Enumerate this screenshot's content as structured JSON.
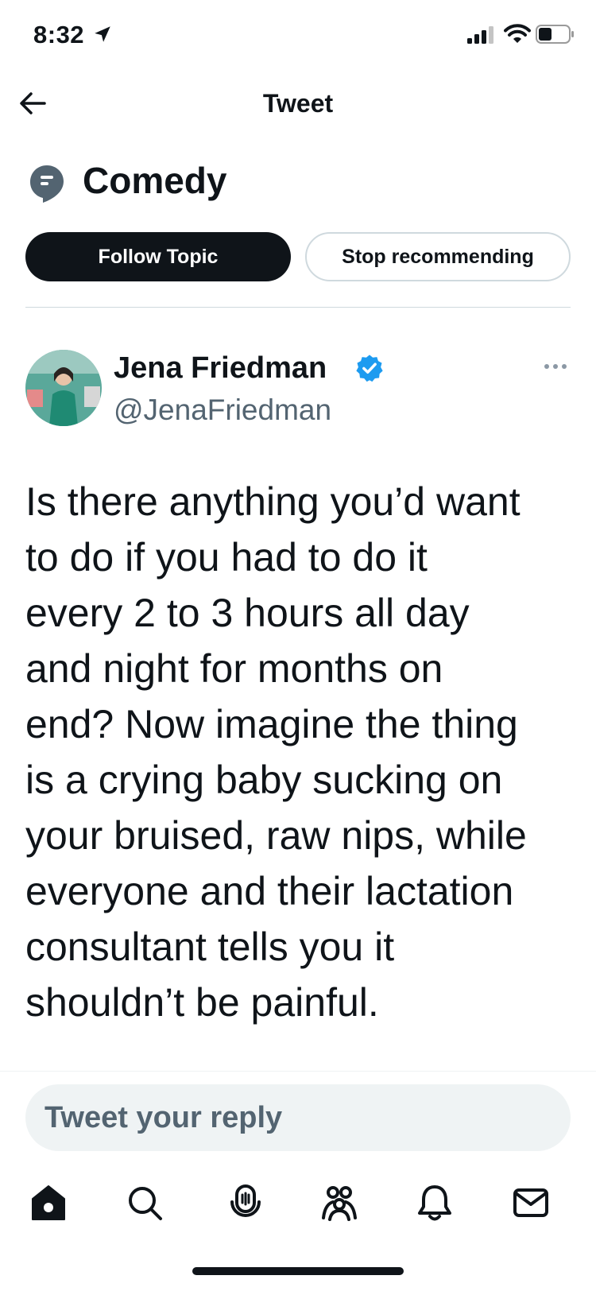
{
  "status_bar": {
    "time": "8:32",
    "icons": [
      "location-arrow-icon",
      "cellular-signal-icon",
      "wifi-icon",
      "battery-icon"
    ]
  },
  "header": {
    "title": "Tweet",
    "back_icon": "arrow-left-icon"
  },
  "topic": {
    "icon": "topic-bubble-icon",
    "name": "Comedy",
    "follow_label": "Follow Topic",
    "stop_label": "Stop recommending"
  },
  "tweet": {
    "author_name": "Jena Friedman",
    "handle": "@JenaFriedman",
    "verified": true,
    "text": "Is there anything you’d want\nto do if you had to do it\nevery 2 to 3 hours all day\nand night for months on\nend? Now imagine the thing\nis a crying baby sucking on\nyour bruised, raw nips, while\neveryone and their lactation\nconsultant tells you it\nshouldn’t be painful."
  },
  "reply": {
    "placeholder": "Tweet your reply"
  },
  "bottom_nav": {
    "items": [
      "home-icon",
      "search-icon",
      "spaces-icon",
      "communities-icon",
      "notifications-icon",
      "messages-icon"
    ]
  },
  "colors": {
    "text": "#0f1419",
    "secondary": "#536471",
    "verified": "#1d9bf0",
    "border": "#cfd9de",
    "reply_bg": "#eff3f4"
  }
}
